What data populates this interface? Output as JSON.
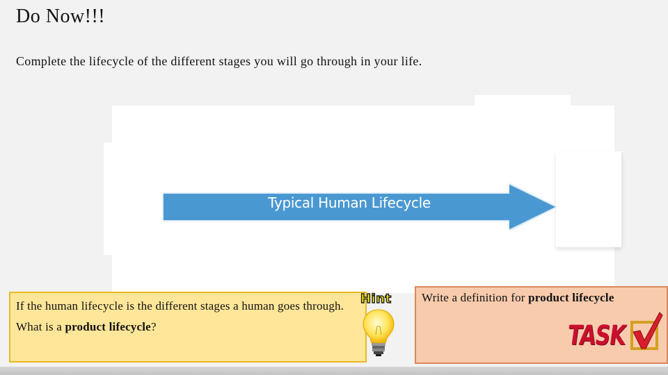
{
  "slide": {
    "title": "Do Now!!!",
    "instruction": "Complete the lifecycle of the different stages you will go through in your life.",
    "lifecycle_arrow": {
      "label": "Typical Human Lifecycle",
      "color": "#4a98d1"
    },
    "hint": {
      "badge_text": "Hint",
      "icon": "lightbulb-icon",
      "text_before": "If the human lifecycle is the different stages a human goes through. What is a ",
      "text_bold": "product lifecycle",
      "text_after": "?",
      "bg_color": "#ffe699",
      "border_color": "#e8b923"
    },
    "task": {
      "badge_text": "TASK",
      "icon": "checkbox-tick-icon",
      "text_before": "Write a definition for ",
      "text_bold": "product lifecycle",
      "bg_color": "#f8cbad",
      "border_color": "#d9875a"
    }
  }
}
